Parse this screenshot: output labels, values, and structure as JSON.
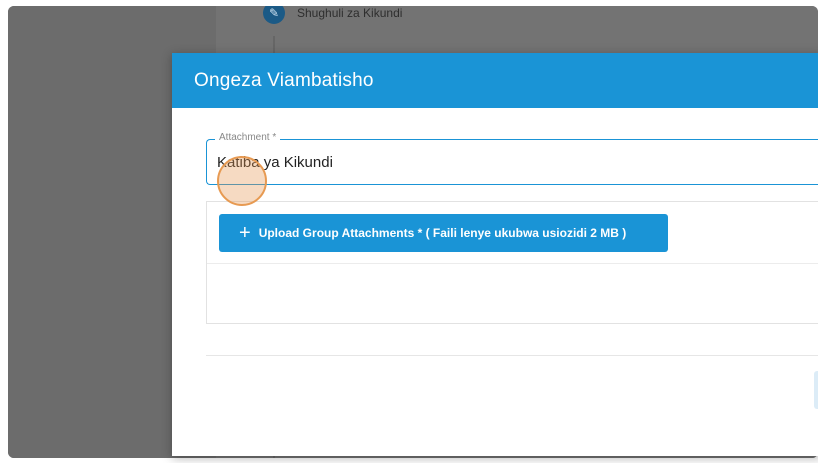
{
  "background": {
    "step_label": "Shughuli za Kikundi"
  },
  "modal": {
    "title": "Ongeza Viambatisho",
    "attachment_field": {
      "label": "Attachment *",
      "value": "Katiba ya Kikundi"
    },
    "upload_button": {
      "label": "Upload Group Attachments * ( Faili lenye ukubwa usiozidi 2 MB )"
    }
  },
  "colors": {
    "accent": "#1a94d6",
    "overlay": "#6e6e6e",
    "click_indicator": "#e79a52"
  }
}
